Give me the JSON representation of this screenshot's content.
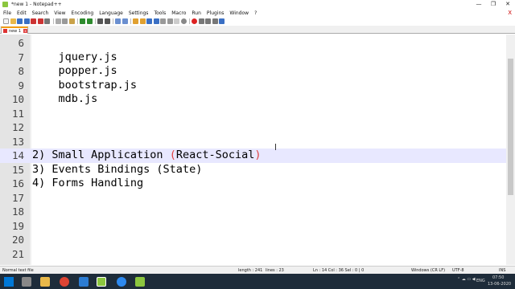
{
  "window": {
    "title": "*new 1 - Notepad++",
    "minimize": "—",
    "maximize": "❐",
    "close": "✕"
  },
  "menu": [
    "File",
    "Edit",
    "Search",
    "View",
    "Encoding",
    "Language",
    "Settings",
    "Tools",
    "Macro",
    "Run",
    "Plugins",
    "Window",
    "?"
  ],
  "menu_close": "X",
  "tabs": [
    {
      "label": "new 1",
      "close": "x"
    }
  ],
  "editor": {
    "lines": [
      {
        "num": "6",
        "text": ""
      },
      {
        "num": "7",
        "text": "    jquery.js"
      },
      {
        "num": "8",
        "text": "    popper.js"
      },
      {
        "num": "9",
        "text": "    bootstrap.js"
      },
      {
        "num": "10",
        "text": "    mdb.js"
      },
      {
        "num": "11",
        "text": ""
      },
      {
        "num": "12",
        "text": ""
      },
      {
        "num": "13",
        "text": ""
      },
      {
        "num": "14",
        "text_a": "2) Small Application ",
        "paren_open": "(",
        "text_b": "React-Social",
        "paren_close": ")"
      },
      {
        "num": "15",
        "text": "3) Events Bindings (State)"
      },
      {
        "num": "16",
        "text": "4) Forms Handling"
      },
      {
        "num": "17",
        "text": ""
      },
      {
        "num": "18",
        "text": ""
      },
      {
        "num": "19",
        "text": ""
      },
      {
        "num": "20",
        "text": ""
      },
      {
        "num": "21",
        "text": ""
      }
    ],
    "current_line": "14"
  },
  "status": {
    "file_type": "Normal text file",
    "length": "length : 241",
    "lines": "lines : 23",
    "position": "Ln : 14    Col : 36    Sel : 0 | 0",
    "eol": "Windows (CR LF)",
    "encoding": "UTF-8",
    "mode": "INS"
  },
  "taskbar": {
    "lang": "ENG",
    "time": "07:50",
    "date": "13-06-2020"
  },
  "colors": {
    "accent_tab": "#f39c12",
    "current_line": "#e8e8ff",
    "brace": "#e04040",
    "gutter": "#e4e4e4",
    "taskbar": "#1e2c3a"
  }
}
